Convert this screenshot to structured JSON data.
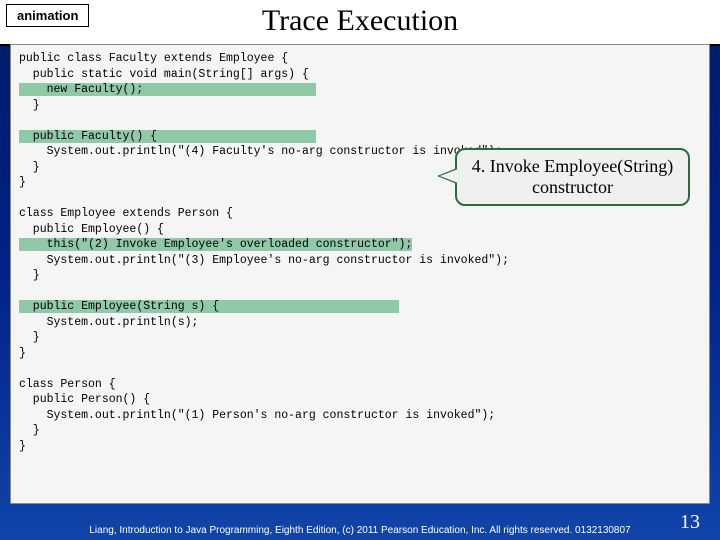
{
  "label": "animation",
  "title": "Trace Execution",
  "code": {
    "l1": "public class Faculty extends Employee {",
    "l2": "  public static void main(String[] args) {",
    "l3_hl": "    new Faculty();                         ",
    "l4": "  }",
    "l5": "",
    "l6_hl": "  public Faculty() {                       ",
    "l7": "    System.out.println(\"(4) Faculty's no-arg constructor is invoked\");",
    "l8": "  }",
    "l9": "}",
    "l10": "",
    "l11": "class Employee extends Person {",
    "l12": "  public Employee() {",
    "l13_hl": "    this(\"(2) Invoke Employee's overloaded constructor\");",
    "l14": "    System.out.println(\"(3) Employee's no-arg constructor is invoked\");",
    "l15": "  }",
    "l16": "",
    "l17_hl": "  public Employee(String s) {                          ",
    "l18": "    System.out.println(s);",
    "l19": "  }",
    "l20": "}",
    "l21": "",
    "l22": "class Person {",
    "l23": "  public Person() {",
    "l24": "    System.out.println(\"(1) Person's no-arg constructor is invoked\");",
    "l25": "  }",
    "l26": "}"
  },
  "callout": "4. Invoke Employee(String) constructor",
  "footer": "Liang, Introduction to Java Programming, Eighth Edition, (c) 2011 Pearson Education, Inc. All rights reserved. 0132130807",
  "page": "13"
}
